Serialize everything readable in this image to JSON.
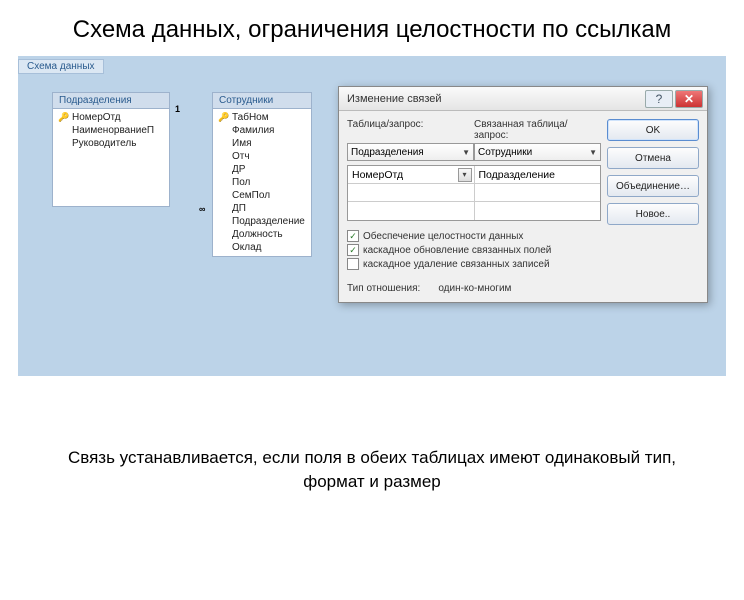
{
  "title": "Схема данных, ограничения целостности по ссылкам",
  "workspace_tab": "Схема данных",
  "tables": {
    "t1": {
      "name": "Подразделения",
      "fields": [
        "НомерОтд",
        "НаименорваниеП",
        "Руководитель"
      ],
      "key_indices": [
        0
      ]
    },
    "t2": {
      "name": "Сотрудники",
      "fields": [
        "ТабНом",
        "Фамилия",
        "Имя",
        "Отч",
        "ДР",
        "Пол",
        "СемПол",
        "ДП",
        "Подразделение",
        "Должность",
        "Оклад"
      ],
      "key_indices": [
        0
      ]
    }
  },
  "relationship": {
    "left_card": "1",
    "right_card": "∞"
  },
  "dialog": {
    "title": "Изменение связей",
    "labels": {
      "table": "Таблица/запрос:",
      "related": "Связанная таблица/запрос:"
    },
    "combos": {
      "left": "Подразделения",
      "right": "Сотрудники"
    },
    "grid": {
      "row1_left": "НомерОтд",
      "row1_right": "Подразделение"
    },
    "checks": {
      "c1": {
        "label": "Обеспечение целостности данных",
        "checked": true
      },
      "c2": {
        "label": "каскадное обновление связанных полей",
        "checked": true
      },
      "c3": {
        "label": "каскадное удаление связанных записей",
        "checked": false
      }
    },
    "type_label": "Тип отношения:",
    "type_value": "один-ко-многим",
    "buttons": {
      "ok": "OK",
      "cancel": "Отмена",
      "join": "Объединение…",
      "new": "Новое.."
    }
  },
  "footer": "Связь устанавливается, если поля в обеих таблицах имеют одинаковый тип, формат и размер"
}
